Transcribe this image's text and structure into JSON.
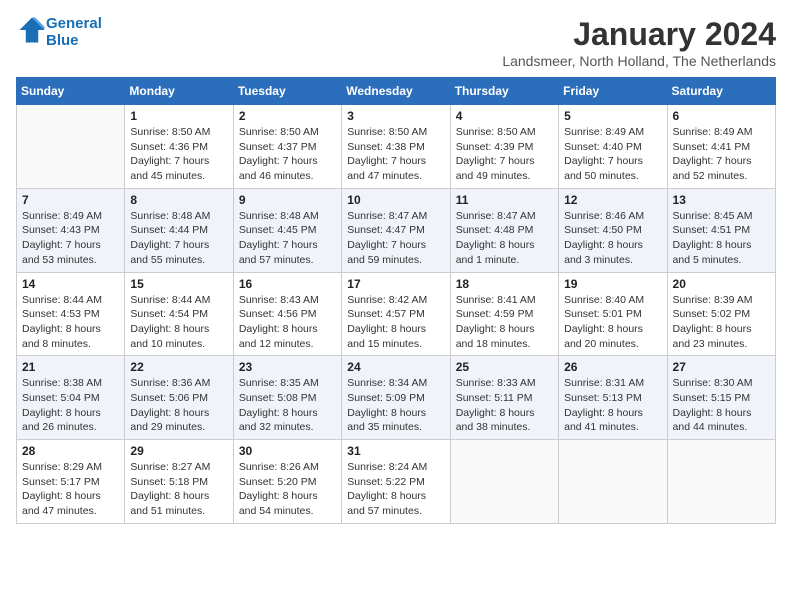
{
  "header": {
    "logo_line1": "General",
    "logo_line2": "Blue",
    "month": "January 2024",
    "location": "Landsmeer, North Holland, The Netherlands"
  },
  "weekdays": [
    "Sunday",
    "Monday",
    "Tuesday",
    "Wednesday",
    "Thursday",
    "Friday",
    "Saturday"
  ],
  "weeks": [
    [
      {
        "day": "",
        "sunrise": "",
        "sunset": "",
        "daylight": ""
      },
      {
        "day": "1",
        "sunrise": "Sunrise: 8:50 AM",
        "sunset": "Sunset: 4:36 PM",
        "daylight": "Daylight: 7 hours and 45 minutes."
      },
      {
        "day": "2",
        "sunrise": "Sunrise: 8:50 AM",
        "sunset": "Sunset: 4:37 PM",
        "daylight": "Daylight: 7 hours and 46 minutes."
      },
      {
        "day": "3",
        "sunrise": "Sunrise: 8:50 AM",
        "sunset": "Sunset: 4:38 PM",
        "daylight": "Daylight: 7 hours and 47 minutes."
      },
      {
        "day": "4",
        "sunrise": "Sunrise: 8:50 AM",
        "sunset": "Sunset: 4:39 PM",
        "daylight": "Daylight: 7 hours and 49 minutes."
      },
      {
        "day": "5",
        "sunrise": "Sunrise: 8:49 AM",
        "sunset": "Sunset: 4:40 PM",
        "daylight": "Daylight: 7 hours and 50 minutes."
      },
      {
        "day": "6",
        "sunrise": "Sunrise: 8:49 AM",
        "sunset": "Sunset: 4:41 PM",
        "daylight": "Daylight: 7 hours and 52 minutes."
      }
    ],
    [
      {
        "day": "7",
        "sunrise": "Sunrise: 8:49 AM",
        "sunset": "Sunset: 4:43 PM",
        "daylight": "Daylight: 7 hours and 53 minutes."
      },
      {
        "day": "8",
        "sunrise": "Sunrise: 8:48 AM",
        "sunset": "Sunset: 4:44 PM",
        "daylight": "Daylight: 7 hours and 55 minutes."
      },
      {
        "day": "9",
        "sunrise": "Sunrise: 8:48 AM",
        "sunset": "Sunset: 4:45 PM",
        "daylight": "Daylight: 7 hours and 57 minutes."
      },
      {
        "day": "10",
        "sunrise": "Sunrise: 8:47 AM",
        "sunset": "Sunset: 4:47 PM",
        "daylight": "Daylight: 7 hours and 59 minutes."
      },
      {
        "day": "11",
        "sunrise": "Sunrise: 8:47 AM",
        "sunset": "Sunset: 4:48 PM",
        "daylight": "Daylight: 8 hours and 1 minute."
      },
      {
        "day": "12",
        "sunrise": "Sunrise: 8:46 AM",
        "sunset": "Sunset: 4:50 PM",
        "daylight": "Daylight: 8 hours and 3 minutes."
      },
      {
        "day": "13",
        "sunrise": "Sunrise: 8:45 AM",
        "sunset": "Sunset: 4:51 PM",
        "daylight": "Daylight: 8 hours and 5 minutes."
      }
    ],
    [
      {
        "day": "14",
        "sunrise": "Sunrise: 8:44 AM",
        "sunset": "Sunset: 4:53 PM",
        "daylight": "Daylight: 8 hours and 8 minutes."
      },
      {
        "day": "15",
        "sunrise": "Sunrise: 8:44 AM",
        "sunset": "Sunset: 4:54 PM",
        "daylight": "Daylight: 8 hours and 10 minutes."
      },
      {
        "day": "16",
        "sunrise": "Sunrise: 8:43 AM",
        "sunset": "Sunset: 4:56 PM",
        "daylight": "Daylight: 8 hours and 12 minutes."
      },
      {
        "day": "17",
        "sunrise": "Sunrise: 8:42 AM",
        "sunset": "Sunset: 4:57 PM",
        "daylight": "Daylight: 8 hours and 15 minutes."
      },
      {
        "day": "18",
        "sunrise": "Sunrise: 8:41 AM",
        "sunset": "Sunset: 4:59 PM",
        "daylight": "Daylight: 8 hours and 18 minutes."
      },
      {
        "day": "19",
        "sunrise": "Sunrise: 8:40 AM",
        "sunset": "Sunset: 5:01 PM",
        "daylight": "Daylight: 8 hours and 20 minutes."
      },
      {
        "day": "20",
        "sunrise": "Sunrise: 8:39 AM",
        "sunset": "Sunset: 5:02 PM",
        "daylight": "Daylight: 8 hours and 23 minutes."
      }
    ],
    [
      {
        "day": "21",
        "sunrise": "Sunrise: 8:38 AM",
        "sunset": "Sunset: 5:04 PM",
        "daylight": "Daylight: 8 hours and 26 minutes."
      },
      {
        "day": "22",
        "sunrise": "Sunrise: 8:36 AM",
        "sunset": "Sunset: 5:06 PM",
        "daylight": "Daylight: 8 hours and 29 minutes."
      },
      {
        "day": "23",
        "sunrise": "Sunrise: 8:35 AM",
        "sunset": "Sunset: 5:08 PM",
        "daylight": "Daylight: 8 hours and 32 minutes."
      },
      {
        "day": "24",
        "sunrise": "Sunrise: 8:34 AM",
        "sunset": "Sunset: 5:09 PM",
        "daylight": "Daylight: 8 hours and 35 minutes."
      },
      {
        "day": "25",
        "sunrise": "Sunrise: 8:33 AM",
        "sunset": "Sunset: 5:11 PM",
        "daylight": "Daylight: 8 hours and 38 minutes."
      },
      {
        "day": "26",
        "sunrise": "Sunrise: 8:31 AM",
        "sunset": "Sunset: 5:13 PM",
        "daylight": "Daylight: 8 hours and 41 minutes."
      },
      {
        "day": "27",
        "sunrise": "Sunrise: 8:30 AM",
        "sunset": "Sunset: 5:15 PM",
        "daylight": "Daylight: 8 hours and 44 minutes."
      }
    ],
    [
      {
        "day": "28",
        "sunrise": "Sunrise: 8:29 AM",
        "sunset": "Sunset: 5:17 PM",
        "daylight": "Daylight: 8 hours and 47 minutes."
      },
      {
        "day": "29",
        "sunrise": "Sunrise: 8:27 AM",
        "sunset": "Sunset: 5:18 PM",
        "daylight": "Daylight: 8 hours and 51 minutes."
      },
      {
        "day": "30",
        "sunrise": "Sunrise: 8:26 AM",
        "sunset": "Sunset: 5:20 PM",
        "daylight": "Daylight: 8 hours and 54 minutes."
      },
      {
        "day": "31",
        "sunrise": "Sunrise: 8:24 AM",
        "sunset": "Sunset: 5:22 PM",
        "daylight": "Daylight: 8 hours and 57 minutes."
      },
      {
        "day": "",
        "sunrise": "",
        "sunset": "",
        "daylight": ""
      },
      {
        "day": "",
        "sunrise": "",
        "sunset": "",
        "daylight": ""
      },
      {
        "day": "",
        "sunrise": "",
        "sunset": "",
        "daylight": ""
      }
    ]
  ]
}
